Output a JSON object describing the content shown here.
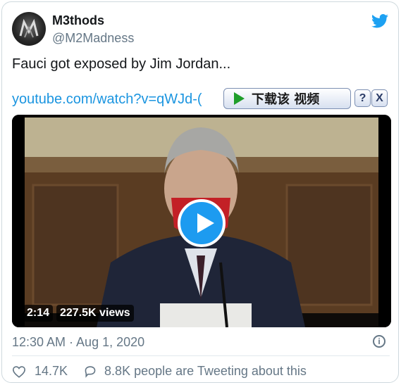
{
  "author": {
    "display_name": "M3thods",
    "handle": "@M2Madness"
  },
  "tweet": {
    "text": "Fauci got exposed by Jim Jordan...",
    "link": "youtube.com/watch?v=qWJd-("
  },
  "download_bar": {
    "label": "下载该 视频",
    "help": "?",
    "close": "X"
  },
  "video": {
    "duration": "2:14",
    "views": "227.5K views"
  },
  "meta": {
    "timestamp": "12:30 AM · Aug 1, 2020",
    "info": "i"
  },
  "actions": {
    "likes": "14.7K",
    "replies_text": "8.8K people are Tweeting about this"
  },
  "colors": {
    "link": "#1b95e0",
    "muted": "#657786",
    "play_button": "#1d9bf0",
    "download_play": "#1f9e2a"
  },
  "icons": [
    "twitter-bird-icon",
    "play-icon",
    "info-icon",
    "heart-icon",
    "reply-icon"
  ]
}
